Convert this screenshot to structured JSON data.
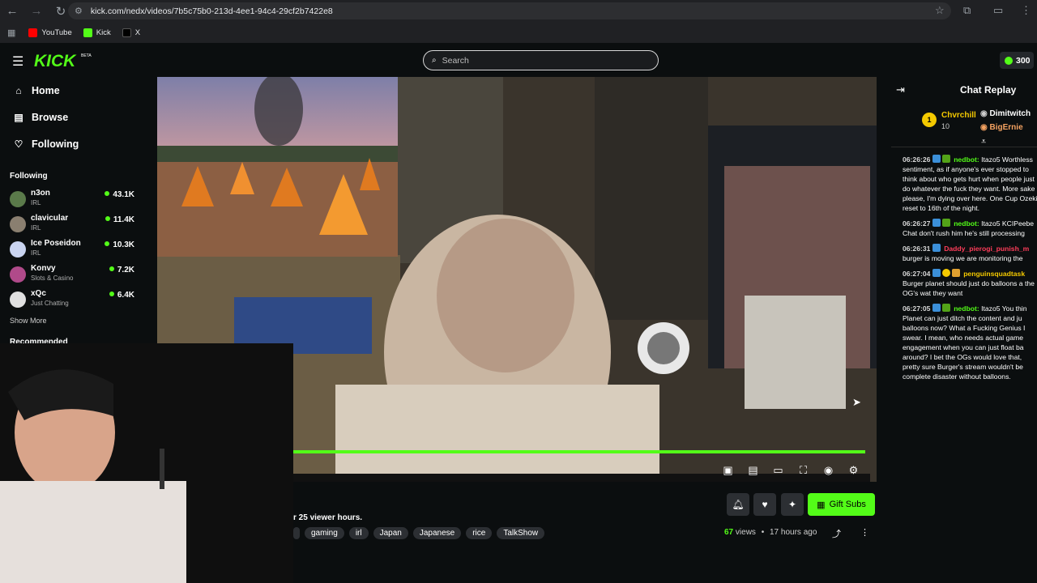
{
  "browser": {
    "url": "kick.com/nedx/videos/7b5c75b0-213d-4ee1-94c4-29cf2b7422e8",
    "bookmarks": [
      "YouTube",
      "Kick",
      "X"
    ]
  },
  "header": {
    "logo": "KICK",
    "beta": "BETA",
    "search_placeholder": "Search",
    "points": "300"
  },
  "sidebar": {
    "nav": [
      "Home",
      "Browse",
      "Following"
    ],
    "following_title": "Following",
    "channels": [
      {
        "name": "n3on",
        "category": "IRL",
        "viewers": "43.1K"
      },
      {
        "name": "clavicular",
        "category": "IRL",
        "viewers": "11.4K"
      },
      {
        "name": "Ice Poseidon",
        "category": "IRL",
        "viewers": "10.3K"
      },
      {
        "name": "Konvy",
        "category": "Slots & Casino",
        "viewers": "7.2K"
      },
      {
        "name": "xQc",
        "category": "Just Chatting",
        "viewers": "6.4K"
      }
    ],
    "show_more": "Show More",
    "recommended": "Recommended"
  },
  "video": {
    "progress": 0.99,
    "viewer_hours_text": "r 25 viewer hours.",
    "tags": [
      "",
      "gaming",
      "irl",
      "Japan",
      "Japanese",
      "rice",
      "TalkShow"
    ],
    "gift_label": "Gift Subs",
    "views_count": "67",
    "views_label": "views",
    "age": "17 hours ago"
  },
  "chat": {
    "title": "Chat Replay",
    "gifters": [
      {
        "rank": "1",
        "name": "Chvrchill",
        "count": "10"
      },
      {
        "name": "Dimitwitch"
      },
      {
        "name": "BigErnie"
      }
    ],
    "messages": [
      {
        "time": "06:26:26",
        "user": "nedbot:",
        "user_color": "#53fc18",
        "text": " Itazo5 Worthless sentiment, as if anyone's ever stopped to think about who gets hurt when people just do whatever the fuck they want. More sake please, I'm dying over here. One Cup Ozeki, reset to 16th of the night."
      },
      {
        "time": "06:26:27",
        "user": "nedbot:",
        "user_color": "#53fc18",
        "text": " Itazo5 KCIPeebe Chat don't rush him he's still processing"
      },
      {
        "time": "06:26:31",
        "user": "Daddy_pierogi_punish_m",
        "user_color": "#ff3d5a",
        "text": " burger is moving we are monitoring the"
      },
      {
        "time": "06:27:04",
        "user": "penguinsquadtask",
        "user_color": "#f4c900",
        "text": " Burger planet should just do balloons a the OG's wat they want"
      },
      {
        "time": "06:27:05",
        "user": "nedbot:",
        "user_color": "#53fc18",
        "text": " Itazo5 You thin Planet can just ditch the content and ju balloons now? What a Fucking Genius I swear. I mean, who needs actual game engagement when you can just float ba around? I bet the OGs would love that, pretty sure Burger's stream wouldn't be complete disaster without balloons."
      }
    ]
  },
  "colors": {
    "accent": "#53fc18",
    "background": "#0b0e0f"
  }
}
